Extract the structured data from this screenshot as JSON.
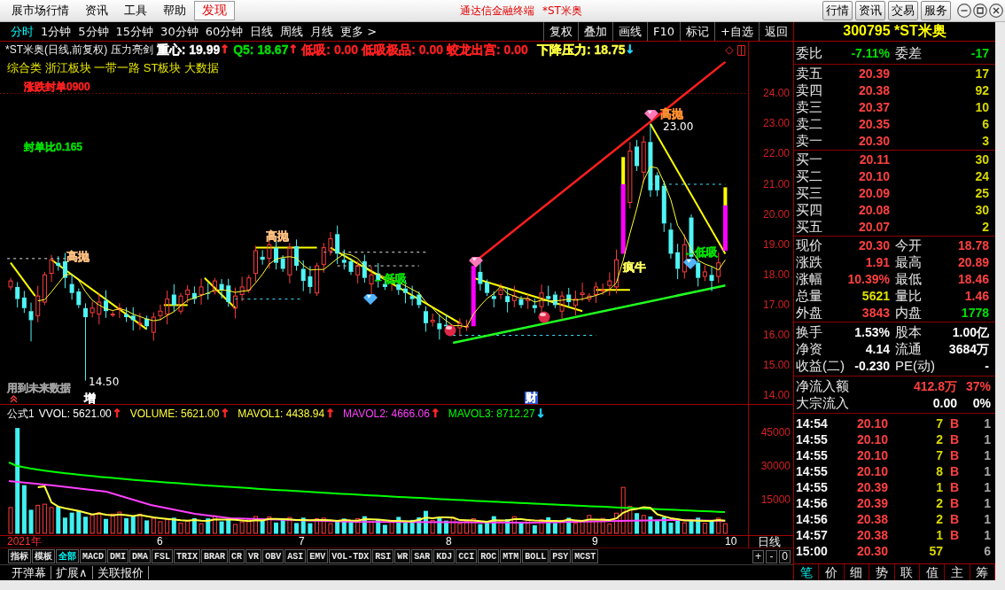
{
  "title_bar": {
    "menus": [
      {
        "label": "展市场行情",
        "selected": false
      },
      {
        "label": "资讯",
        "selected": false
      },
      {
        "label": "工具",
        "selected": false
      },
      {
        "label": "帮助",
        "selected": false
      },
      {
        "label": "发现",
        "selected": true
      }
    ],
    "app_name": "通达信金融终端",
    "stock_name": "*ST米奥",
    "buttons": [
      "行情",
      "资讯",
      "交易",
      "服务"
    ]
  },
  "period_tabs": [
    {
      "label": "分时",
      "selected": true
    },
    {
      "label": "1分钟",
      "selected": false
    },
    {
      "label": "5分钟",
      "selected": false
    },
    {
      "label": "15分钟",
      "selected": false
    },
    {
      "label": "30分钟",
      "selected": false
    },
    {
      "label": "60分钟",
      "selected": false
    },
    {
      "label": "日线",
      "selected": false
    },
    {
      "label": "周线",
      "selected": false
    },
    {
      "label": "月线",
      "selected": false
    },
    {
      "label": "更多 >",
      "selected": false
    }
  ],
  "chart_tools": [
    "复权",
    "叠加",
    "画线",
    "F10",
    "标记",
    "+自选",
    "返回"
  ],
  "price_chart": {
    "title": "*ST米奥(日线,前复权) 压力亮剑",
    "readings": [
      {
        "text": "重心: 19.99",
        "color": "#ffffff",
        "arrow": {
          "glyph": "↑",
          "color": "#ff2828"
        }
      },
      {
        "text": "Q5: 18.67",
        "color": "#00e000",
        "arrow": {
          "glyph": "↑",
          "color": "#ff2828"
        }
      },
      {
        "text": "低吸: 0.00",
        "color": "#ff2020"
      },
      {
        "text": "低吸极品: 0.00",
        "color": "#ff2020"
      },
      {
        "text": "蛟龙出宫: 0.00",
        "color": "#ff2020"
      }
    ],
    "pressure_reading": {
      "text": "下降压力: 18.75",
      "color": "#ffff40",
      "arrow": {
        "glyph": "↓",
        "color": "#20d8ff"
      }
    },
    "sectors": "综合类 浙江板块 一带一路 ST板块 大数据",
    "annotations": [
      {
        "text": "涨跌封单0900",
        "kind": "note",
        "color": "#ff2020"
      },
      {
        "text": "封单比0.165",
        "kind": "note",
        "color": "#00e000"
      },
      {
        "text": "高抛",
        "kind": "signal",
        "color": "#ffc080"
      },
      {
        "text": "高抛",
        "kind": "signal",
        "color": "#ffc080"
      },
      {
        "text": "高抛",
        "kind": "signal",
        "color": "#ff9030"
      },
      {
        "text": "23.00",
        "kind": "price",
        "color": "#ffffff"
      },
      {
        "text": "←低吸",
        "kind": "signal",
        "color": "#00e000"
      },
      {
        "text": "←低吸",
        "kind": "signal",
        "color": "#00e000"
      },
      {
        "text": "疯牛",
        "kind": "signal",
        "color": "#ffff60"
      },
      {
        "text": "14.50",
        "kind": "price",
        "color": "#ffffff"
      },
      {
        "text": "用到未来数据",
        "kind": "note",
        "color": "#a0a0a0"
      },
      {
        "text": "增",
        "kind": "event",
        "boxed": false
      },
      {
        "text": "财",
        "kind": "event",
        "boxed": true
      }
    ],
    "price_axis": [
      "24.00",
      "23.00",
      "22.00",
      "21.00",
      "20.00",
      "19.00",
      "18.00",
      "17.00",
      "16.00",
      "15.00",
      "14.00"
    ]
  },
  "volume_chart": {
    "title": "公式1",
    "readings": [
      {
        "text": "VVOL: 5621.00",
        "color": "#ffffff",
        "arrow": {
          "glyph": "↑",
          "color": "#ff2828"
        }
      },
      {
        "text": "VOLUME: 5621.00",
        "color": "#ffff40",
        "arrow": {
          "glyph": "↑",
          "color": "#ff2828"
        }
      },
      {
        "text": "MAVOL1: 4438.94",
        "color": "#ffff40",
        "arrow": {
          "glyph": "↑",
          "color": "#ff2828"
        }
      },
      {
        "text": "MAVOL2: 4666.06",
        "color": "#ff40ff",
        "arrow": {
          "glyph": "↑",
          "color": "#ff2828"
        }
      },
      {
        "text": "MAVOL3: 8712.27",
        "color": "#00ff00",
        "arrow": {
          "glyph": "↓",
          "color": "#20d8ff"
        }
      }
    ],
    "axis": [
      "45000",
      "30000",
      "15000"
    ],
    "x_axis": [
      {
        "label": "2021年",
        "color": "#ff3030"
      },
      {
        "label": "6",
        "color": "#ffffff"
      },
      {
        "label": "7",
        "color": "#ffffff"
      },
      {
        "label": "8",
        "color": "#ffffff"
      },
      {
        "label": "9",
        "color": "#ffffff"
      },
      {
        "label": "10",
        "color": "#ffffff"
      }
    ],
    "period": "日线",
    "zoom_buttons": [
      "+",
      "-",
      "0"
    ]
  },
  "indicator_tabs": [
    {
      "label": "指标",
      "selected": false
    },
    {
      "label": "模板",
      "selected": false
    },
    {
      "label": "全部",
      "selected": true
    },
    {
      "label": "MACD",
      "selected": false
    },
    {
      "label": "DMI",
      "selected": false
    },
    {
      "label": "DMA",
      "selected": false
    },
    {
      "label": "FSL",
      "selected": false
    },
    {
      "label": "TRIX",
      "selected": false
    },
    {
      "label": "BRAR",
      "selected": false
    },
    {
      "label": "CR",
      "selected": false
    },
    {
      "label": "VR",
      "selected": false
    },
    {
      "label": "OBV",
      "selected": false
    },
    {
      "label": "ASI",
      "selected": false
    },
    {
      "label": "EMV",
      "selected": false
    },
    {
      "label": "VOL-TDX",
      "selected": false
    },
    {
      "label": "RSI",
      "selected": false
    },
    {
      "label": "WR",
      "selected": false
    },
    {
      "label": "SAR",
      "selected": false
    },
    {
      "label": "KDJ",
      "selected": false
    },
    {
      "label": "CCI",
      "selected": false
    },
    {
      "label": "ROC",
      "selected": false
    },
    {
      "label": "MTM",
      "selected": false
    },
    {
      "label": "BOLL",
      "selected": false
    },
    {
      "label": "PSY",
      "selected": false
    },
    {
      "label": "MCST",
      "selected": false
    }
  ],
  "bottom_buttons": [
    "开弹幕",
    "扩展∧",
    "关联报价"
  ],
  "quote_panel": {
    "header": "300795 *ST米奥",
    "ratio": [
      {
        "label": "委比",
        "value": "-7.11%",
        "color": "#00e000"
      },
      {
        "label": "委差",
        "value": "-17",
        "color": "#00e000"
      }
    ],
    "asks": [
      {
        "label": "卖五",
        "price": "20.39",
        "volume": "17"
      },
      {
        "label": "卖四",
        "price": "20.38",
        "volume": "92"
      },
      {
        "label": "卖三",
        "price": "20.37",
        "volume": "10"
      },
      {
        "label": "卖二",
        "price": "20.35",
        "volume": "6"
      },
      {
        "label": "卖一",
        "price": "20.30",
        "volume": "3"
      }
    ],
    "bids": [
      {
        "label": "买一",
        "price": "20.11",
        "volume": "30"
      },
      {
        "label": "买二",
        "price": "20.10",
        "volume": "24"
      },
      {
        "label": "买三",
        "price": "20.09",
        "volume": "25"
      },
      {
        "label": "买四",
        "price": "20.08",
        "volume": "30"
      },
      {
        "label": "买五",
        "price": "20.07",
        "volume": "2"
      }
    ],
    "quotes": [
      [
        {
          "label": "现价",
          "value": "20.30",
          "color": "#ff4040"
        },
        {
          "label": "今开",
          "value": "18.78",
          "color": "#ff4040"
        }
      ],
      [
        {
          "label": "涨跌",
          "value": "1.91",
          "color": "#ff4040"
        },
        {
          "label": "最高",
          "value": "20.89",
          "color": "#ff4040"
        }
      ],
      [
        {
          "label": "涨幅",
          "value": "10.39%",
          "color": "#ff4040"
        },
        {
          "label": "最低",
          "value": "18.46",
          "color": "#ff4040"
        }
      ],
      [
        {
          "label": "总量",
          "value": "5621",
          "color": "#e0e000"
        },
        {
          "label": "量比",
          "value": "1.46",
          "color": "#ff4040"
        }
      ],
      [
        {
          "label": "外盘",
          "value": "3843",
          "color": "#ff4040"
        },
        {
          "label": "内盘",
          "value": "1778",
          "color": "#00e000"
        }
      ]
    ],
    "fundamentals": [
      [
        {
          "label": "换手",
          "value": "1.53%",
          "color": "#ffffff"
        },
        {
          "label": "股本",
          "value": "1.00亿",
          "color": "#ffffff"
        }
      ],
      [
        {
          "label": "净资",
          "value": "4.14",
          "color": "#ffffff"
        },
        {
          "label": "流通",
          "value": "3684万",
          "color": "#ffffff"
        }
      ],
      [
        {
          "label": "收益(二)",
          "value": "-0.230",
          "color": "#ffffff"
        },
        {
          "label": "PE(动)",
          "value": "-",
          "color": "#ffffff"
        }
      ]
    ],
    "flows": [
      {
        "label": "净流入额",
        "value": "412.8万",
        "share": "37%",
        "color": "#ff4040"
      },
      {
        "label": "大宗流入",
        "value": "0.00",
        "share": "0%",
        "color": "#ffffff"
      }
    ],
    "ticks": [
      {
        "time": "14:54",
        "price": "20.10",
        "volume": "7",
        "side": "B",
        "count": "1"
      },
      {
        "time": "14:55",
        "price": "20.10",
        "volume": "2",
        "side": "B",
        "count": "1"
      },
      {
        "time": "14:55",
        "price": "20.10",
        "volume": "7",
        "side": "B",
        "count": "1"
      },
      {
        "time": "14:55",
        "price": "20.10",
        "volume": "8",
        "side": "B",
        "count": "1"
      },
      {
        "time": "14:55",
        "price": "20.39",
        "volume": "1",
        "side": "B",
        "count": "1"
      },
      {
        "time": "14:56",
        "price": "20.39",
        "volume": "2",
        "side": "B",
        "count": "1"
      },
      {
        "time": "14:56",
        "price": "20.38",
        "volume": "2",
        "side": "B",
        "count": "1"
      },
      {
        "time": "14:57",
        "price": "20.38",
        "volume": "1",
        "side": "B",
        "count": "1"
      },
      {
        "time": "15:00",
        "price": "20.30",
        "volume": "57",
        "count": "6"
      }
    ],
    "tabs": [
      {
        "label": "笔",
        "selected": true
      },
      {
        "label": "价",
        "selected": false
      },
      {
        "label": "细",
        "selected": false
      },
      {
        "label": "势",
        "selected": false
      },
      {
        "label": "联",
        "selected": false
      },
      {
        "label": "值",
        "selected": false
      },
      {
        "label": "主",
        "selected": false
      },
      {
        "label": "筹",
        "selected": false
      }
    ]
  }
}
